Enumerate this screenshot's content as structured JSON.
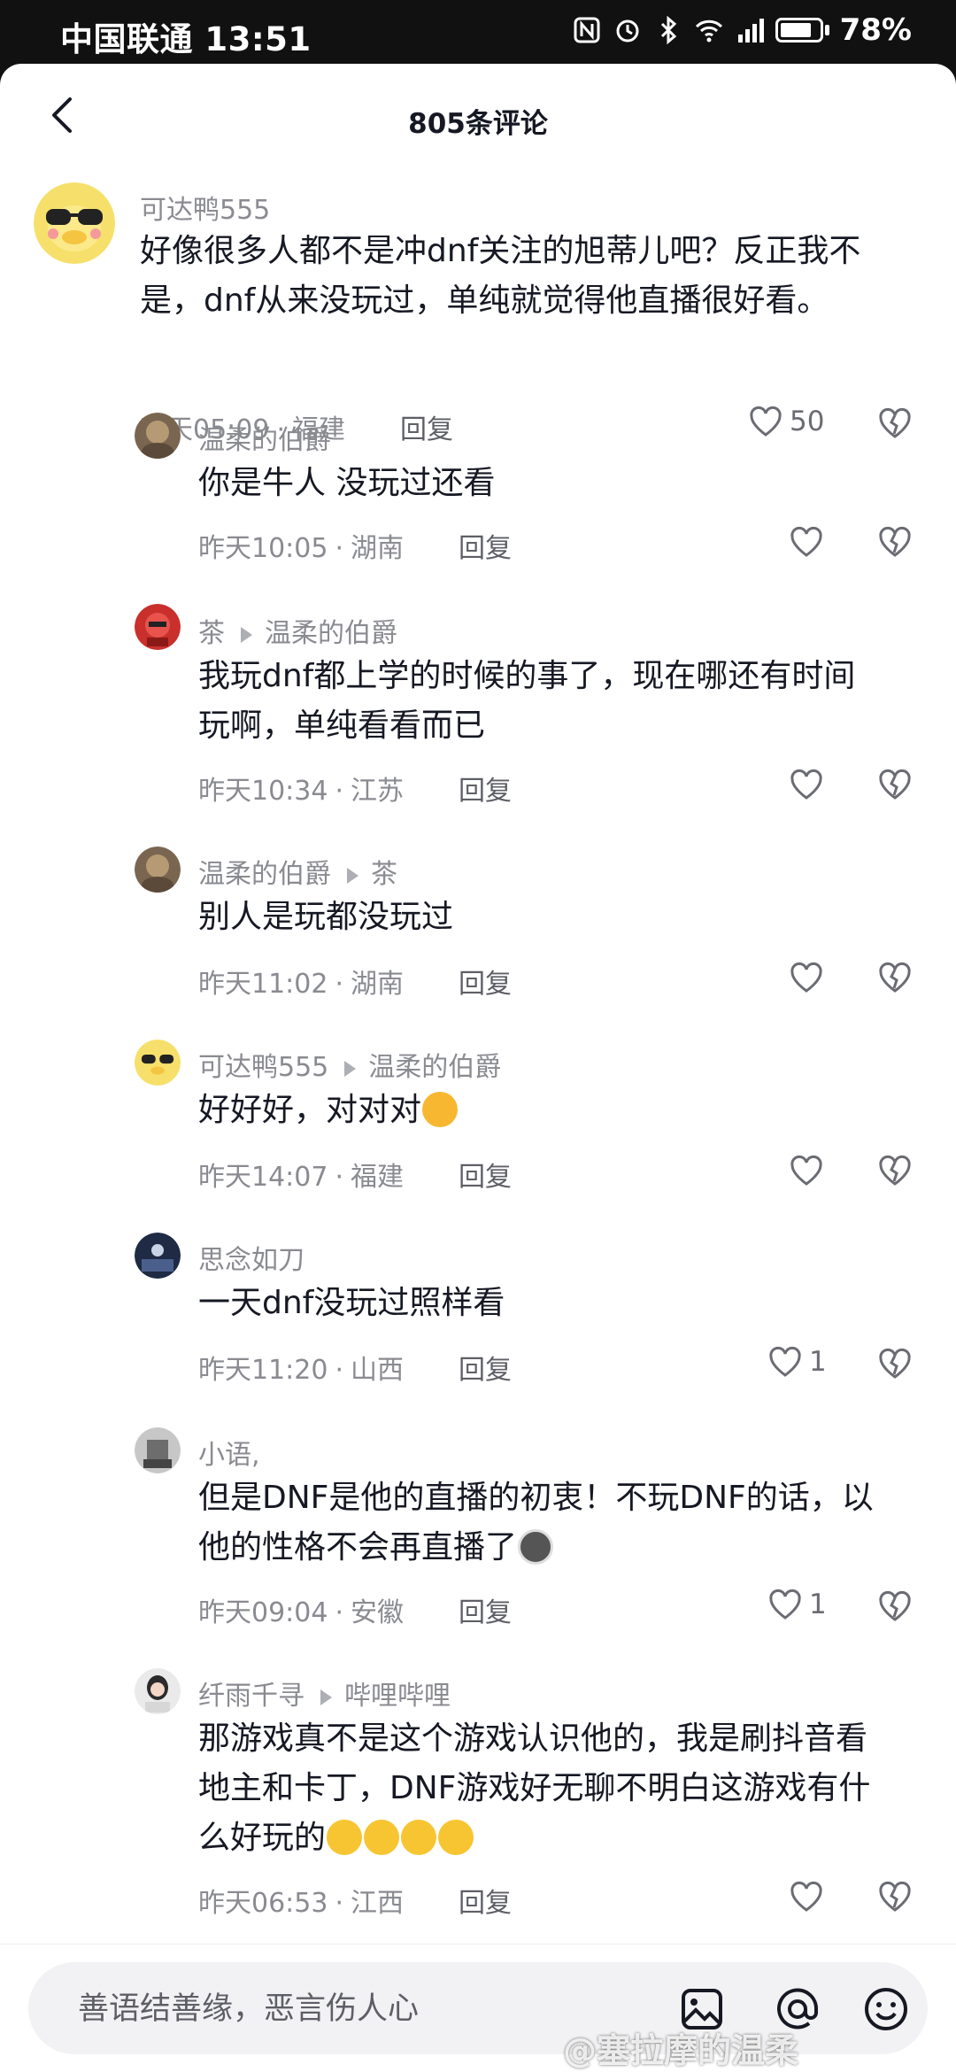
{
  "status_bar": {
    "carrier_time": "中国联通 13:51",
    "battery": "78%"
  },
  "header": {
    "title": "805条评论"
  },
  "comments": [
    {
      "user": "可达鸭555",
      "text1": "好像很多人都不是冲dnf关注的旭蒂儿吧？反正我不",
      "text2": "是，dnf从来没玩过，单纯就觉得他直播很好看。",
      "time": "昨天05:09",
      "location": "福建",
      "reply": "回复",
      "likes": "50"
    },
    {
      "user": "温柔的伯爵",
      "text1": "你是牛人  没玩过还看",
      "time": "昨天10:05",
      "location": "湖南",
      "reply": "回复"
    },
    {
      "user": "茶",
      "reply_to": "温柔的伯爵",
      "text1": "我玩dnf都上学的时候的事了，现在哪还有时间",
      "text2": "玩啊，单纯看看而已",
      "time": "昨天10:34",
      "location": "江苏",
      "reply": "回复"
    },
    {
      "user": "温柔的伯爵",
      "reply_to": "茶",
      "text1": "别人是玩都没玩过",
      "time": "昨天11:02",
      "location": "湖南",
      "reply": "回复"
    },
    {
      "user": "可达鸭555",
      "reply_to": "温柔的伯爵",
      "text1": "好好好，对对对",
      "time": "昨天14:07",
      "location": "福建",
      "reply": "回复"
    },
    {
      "user": "思念如刀",
      "text1": "一天dnf没玩过照样看",
      "time": "昨天11:20",
      "location": "山西",
      "reply": "回复",
      "likes": "1"
    },
    {
      "user": "小语,",
      "text1": "但是DNF是他的直播的初衷！不玩DNF的话，以",
      "text2": "他的性格不会再直播了",
      "time": "昨天09:04",
      "location": "安徽",
      "reply": "回复",
      "likes": "1"
    },
    {
      "user": "纤雨千寻",
      "reply_to": "哔哩哔哩",
      "text1": "那游戏真不是这个游戏认识他的，我是刷抖音看",
      "text2": "地主和卡丁，DNF游戏好无聊不明白这游戏有什",
      "text3": "么好玩的",
      "time": "昨天06:53",
      "location": "江西",
      "reply": "回复"
    }
  ],
  "input": {
    "placeholder": "善语结善缘，恶言伤人心"
  },
  "watermark": "@塞拉摩的温柔",
  "icons": [
    "back-icon",
    "heart-icon",
    "broken-heart-icon",
    "image-icon",
    "at-icon",
    "emoji-icon"
  ],
  "colors": {
    "text": "#161823",
    "secondary": "#8a8b91",
    "background": "#ffffff"
  }
}
